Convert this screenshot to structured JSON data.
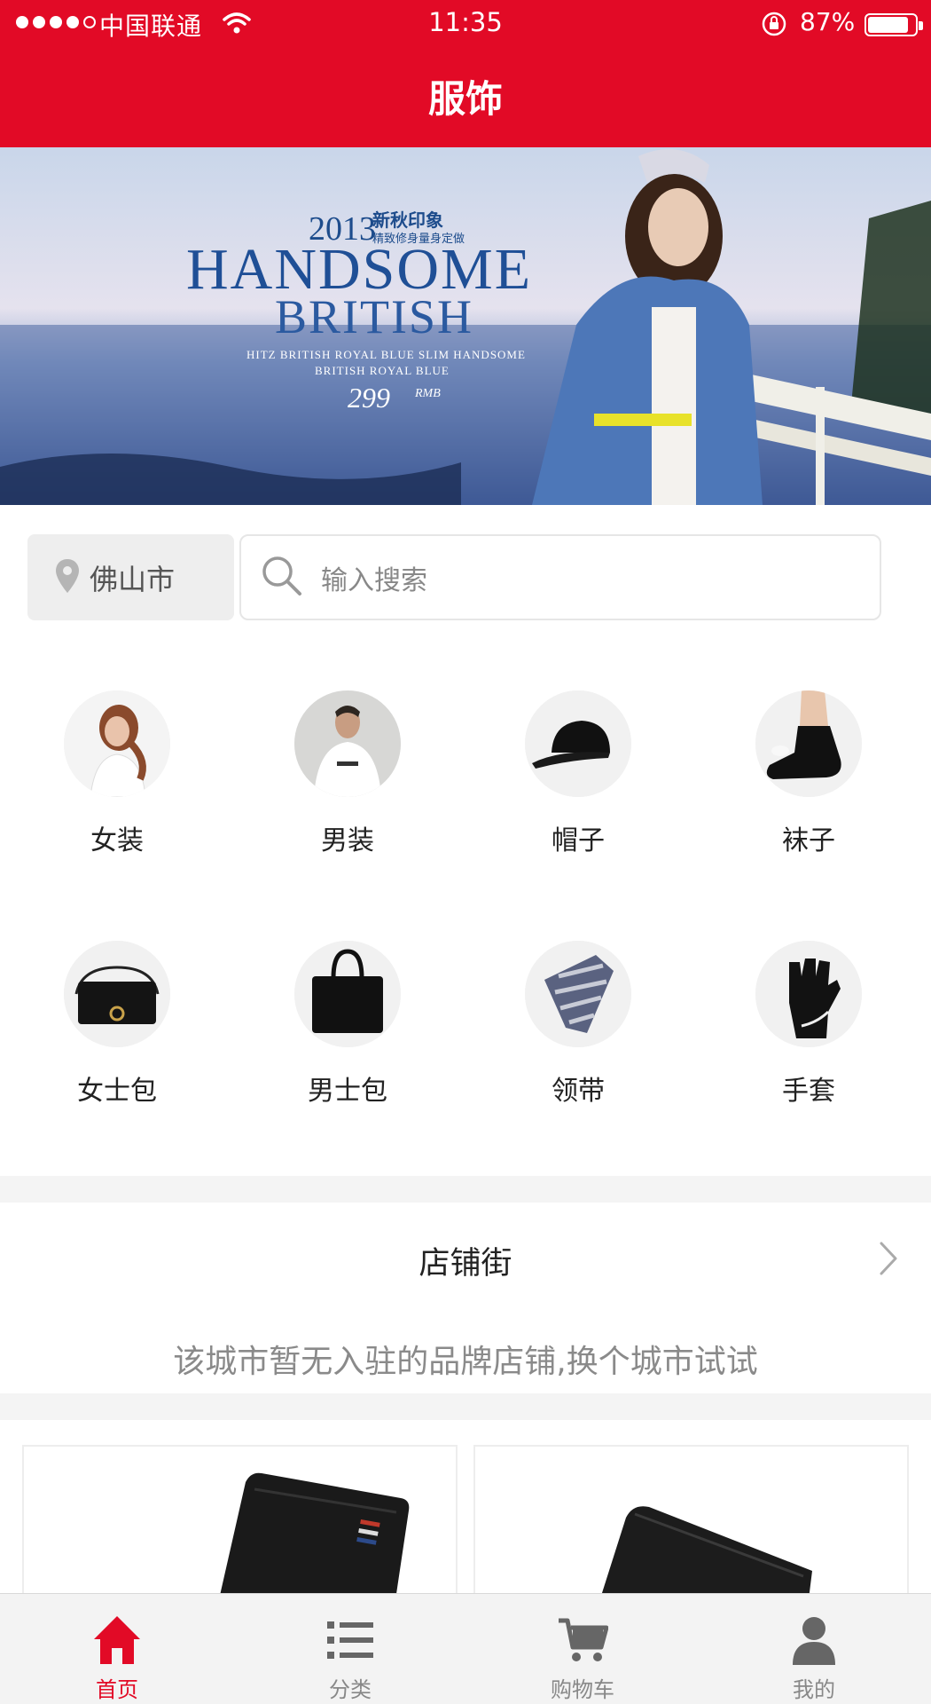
{
  "status_bar": {
    "carrier": "中国联通",
    "time": "11:35",
    "battery": "87%"
  },
  "header": {
    "title": "服饰"
  },
  "banner": {
    "year": "2013",
    "subtitle": "新秋印象",
    "subtitle2": "精致修身量身定做",
    "headline1": "HANDSOME",
    "headline2": "BRITISH",
    "line1": "HITZ BRITISH ROYAL BLUE SLIM HANDSOME",
    "line2": "BRITISH ROYAL BLUE",
    "price": "299",
    "currency": "RMB"
  },
  "location": {
    "city": "佛山市"
  },
  "search": {
    "placeholder": "输入搜索"
  },
  "categories": [
    {
      "label": "女装",
      "icon": "woman-photo"
    },
    {
      "label": "男装",
      "icon": "man-photo"
    },
    {
      "label": "帽子",
      "icon": "cap-photo"
    },
    {
      "label": "袜子",
      "icon": "sock-photo"
    },
    {
      "label": "女士包",
      "icon": "handbag-photo"
    },
    {
      "label": "男士包",
      "icon": "briefcase-photo"
    },
    {
      "label": "领带",
      "icon": "tie-photo"
    },
    {
      "label": "手套",
      "icon": "glove-photo"
    }
  ],
  "store_street": {
    "title": "店铺街",
    "empty_message": "该城市暂无入驻的品牌店铺,换个城市试试"
  },
  "tabbar": {
    "items": [
      {
        "label": "首页",
        "icon": "home-icon",
        "active": true
      },
      {
        "label": "分类",
        "icon": "list-icon",
        "active": false
      },
      {
        "label": "购物车",
        "icon": "cart-icon",
        "active": false
      },
      {
        "label": "我的",
        "icon": "user-icon",
        "active": false
      }
    ]
  },
  "colors": {
    "brand_red": "#e20a26",
    "inactive_gray": "#888888"
  }
}
